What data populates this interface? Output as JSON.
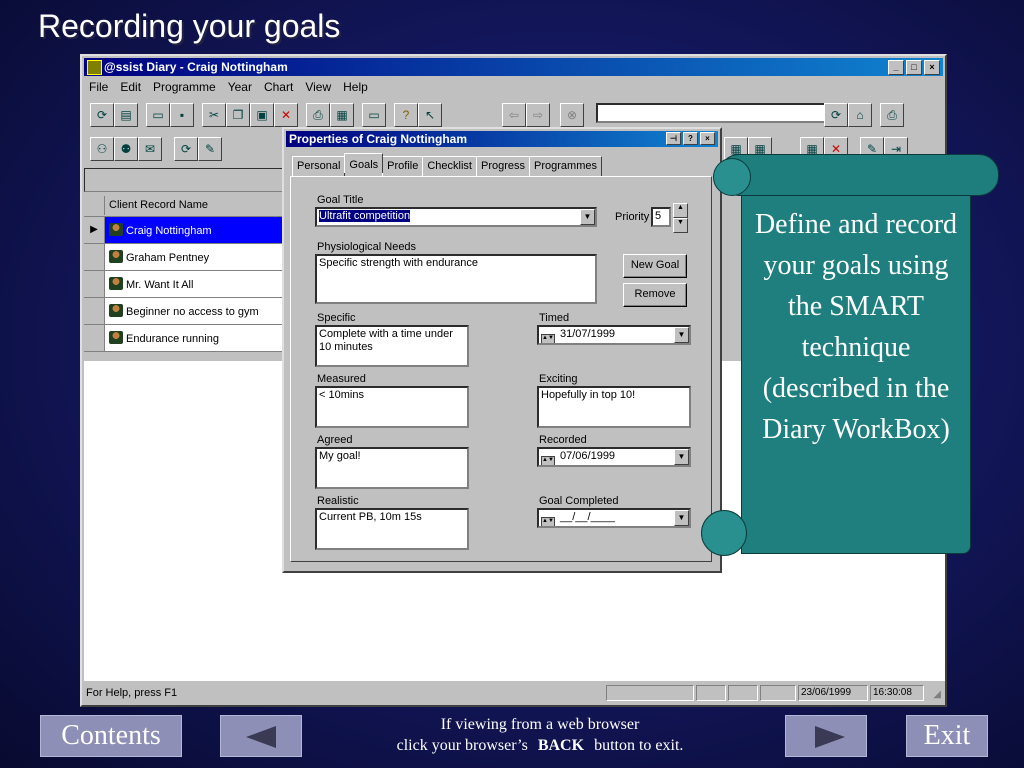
{
  "slide": {
    "title": "Recording your goals"
  },
  "app": {
    "title": "@ssist Diary - Craig Nottingham",
    "menu": [
      "File",
      "Edit",
      "Programme",
      "Year",
      "Chart",
      "View",
      "Help"
    ],
    "grid": {
      "header": "Client Record Name",
      "rows": [
        "Craig Nottingham",
        "Graham Pentney",
        "Mr. Want It All",
        "Beginner no access to gym",
        "Endurance running"
      ],
      "selected_row": 0
    },
    "status": {
      "help": "For Help, press F1",
      "date": "23/06/1999",
      "time": "16:30:08"
    }
  },
  "dialog": {
    "title": "Properties of Craig Nottingham",
    "tabs": [
      "Personal",
      "Goals",
      "Profile",
      "Checklist",
      "Progress",
      "Programmes"
    ],
    "active_tab": "Goals",
    "goal_title_label": "Goal Title",
    "goal_title_value": "Ultrafit competition",
    "priority_label": "Priority",
    "priority_value": "5",
    "physiological_label": "Physiological Needs",
    "physiological_value": "Specific strength with endurance",
    "new_goal_button": "New Goal",
    "remove_button": "Remove",
    "specific_label": "Specific",
    "specific_value": "Complete with a time under 10 minutes",
    "timed_label": "Timed",
    "timed_value": "31/07/1999",
    "measured_label": "Measured",
    "measured_value": "< 10mins",
    "exciting_label": "Exciting",
    "exciting_value": "Hopefully in top 10!",
    "agreed_label": "Agreed",
    "agreed_value": "My goal!",
    "recorded_label": "Recorded",
    "recorded_value": "07/06/1999",
    "realistic_label": "Realistic",
    "realistic_value": "Current PB, 10m 15s",
    "completed_label": "Goal Completed",
    "completed_value": "__/__/____"
  },
  "callout": {
    "text": "Define and record your goals using the SMART technique (described in the Diary WorkBox)",
    "color": "#1f7f7f"
  },
  "nav": {
    "contents": "Contents",
    "exit": "Exit",
    "line1": "If viewing from a web browser",
    "line2_pre": "click your browser’s",
    "line2_bold": "BACK",
    "line2_post": "button to exit."
  }
}
